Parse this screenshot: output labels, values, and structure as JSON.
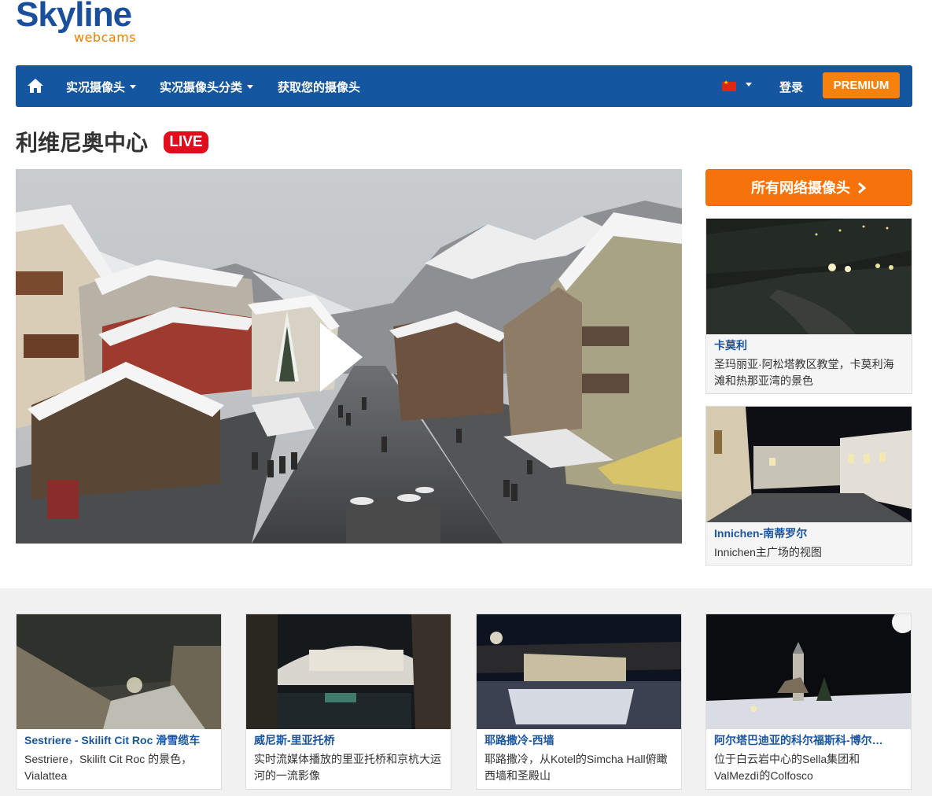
{
  "logo": {
    "main": "Skyline",
    "sub": "webcams"
  },
  "nav": {
    "items": [
      {
        "label": "实况摄像头"
      },
      {
        "label": "实况摄像头分类"
      },
      {
        "label": "获取您的摄像头"
      }
    ],
    "login": "登录",
    "premium": "PREMIUM"
  },
  "page": {
    "title": "利维尼奥中心",
    "live": "LIVE"
  },
  "sidebar": {
    "all_button": "所有网络摄像头",
    "cards": [
      {
        "title": "卡莫利",
        "desc": "圣玛丽亚·阿松塔教区教堂，卡莫利海滩和热那亚湾的景色"
      },
      {
        "title": "Innichen-南蒂罗尔",
        "desc": "Innichen主广场的视图"
      }
    ]
  },
  "related": [
    {
      "title": "Sestriere - Skilift Cit Roc 滑雪缆车",
      "desc": "Sestriere，Skilift Cit Roc 的景色，Vialattea"
    },
    {
      "title": "威尼斯-里亚托桥",
      "desc": "实时流媒体播放的里亚托桥和京杭大运河的一流影像"
    },
    {
      "title": "耶路撒冷-西墙",
      "desc": "耶路撒冷，从Kotel的Simcha Hall俯瞰西墙和圣殿山"
    },
    {
      "title": "阿尔塔巴迪亚的科尔福斯科-博尔…",
      "desc": "位于白云岩中心的Sella集团和ValMezdì的Colfosco"
    }
  ],
  "colors": {
    "nav_bg": "#1456a0",
    "accent_orange": "#f6730b",
    "live_red": "#e10d1c",
    "link_blue": "#1a56a0"
  },
  "icons": {
    "home": "home-icon",
    "flag": "china-flag-icon",
    "play": "play-icon",
    "chevron": "chevron-right-icon"
  }
}
